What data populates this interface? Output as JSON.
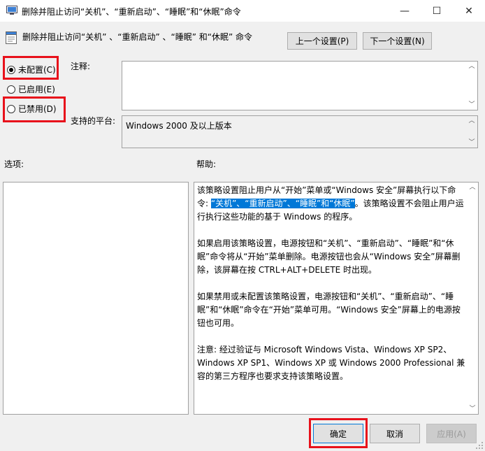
{
  "window": {
    "title": "删除并阻止访问“关机”、“重新启动”、“睡眠”和“休眠”命令",
    "minimize": "—",
    "maximize": "☐",
    "close": "✕"
  },
  "header": {
    "policy_title": "删除并阻止访问“关机” 、“重新启动” 、“睡眠” 和“休眠” 命令",
    "prev_button": "上一个设置(P)",
    "next_button": "下一个设置(N)"
  },
  "state": {
    "not_configured": "未配置(C)",
    "enabled": "已启用(E)",
    "disabled": "已禁用(D)",
    "selected": "not_configured"
  },
  "comment": {
    "label": "注释:",
    "value": ""
  },
  "platform": {
    "label": "支持的平台:",
    "value": "Windows 2000 及以上版本"
  },
  "options": {
    "label": "选项:"
  },
  "help": {
    "label": "帮助:",
    "p1_a": "该策略设置阻止用户从“开始”菜单或“Windows 安全”屏幕执行以下命令: ",
    "p1_highlight": "“关机”、“重新启动”、“睡眠”和“休眠”",
    "p1_b": "。该策略设置不会阻止用户运行执行这些功能的基于 Windows 的程序。",
    "p2": "如果启用该策略设置，电源按钮和“关机”、“重新启动”、“睡眠”和“休眠”命令将从“开始”菜单删除。电源按钮也会从“Windows 安全”屏幕删除，该屏幕在按 CTRL+ALT+DELETE 时出现。",
    "p3": "如果禁用或未配置该策略设置，电源按钮和“关机”、“重新启动”、“睡眠”和“休眠”命令在“开始”菜单可用。“Windows 安全”屏幕上的电源按钮也可用。",
    "p4": "注意: 经过验证与 Microsoft Windows Vista、Windows XP SP2、Windows XP SP1、Windows XP 或 Windows 2000 Professional 兼容的第三方程序也要求支持该策略设置。"
  },
  "footer": {
    "ok": "确定",
    "cancel": "取消",
    "apply": "应用(A)"
  },
  "colors": {
    "highlight": "#e8111b",
    "selection": "#0078d7"
  }
}
